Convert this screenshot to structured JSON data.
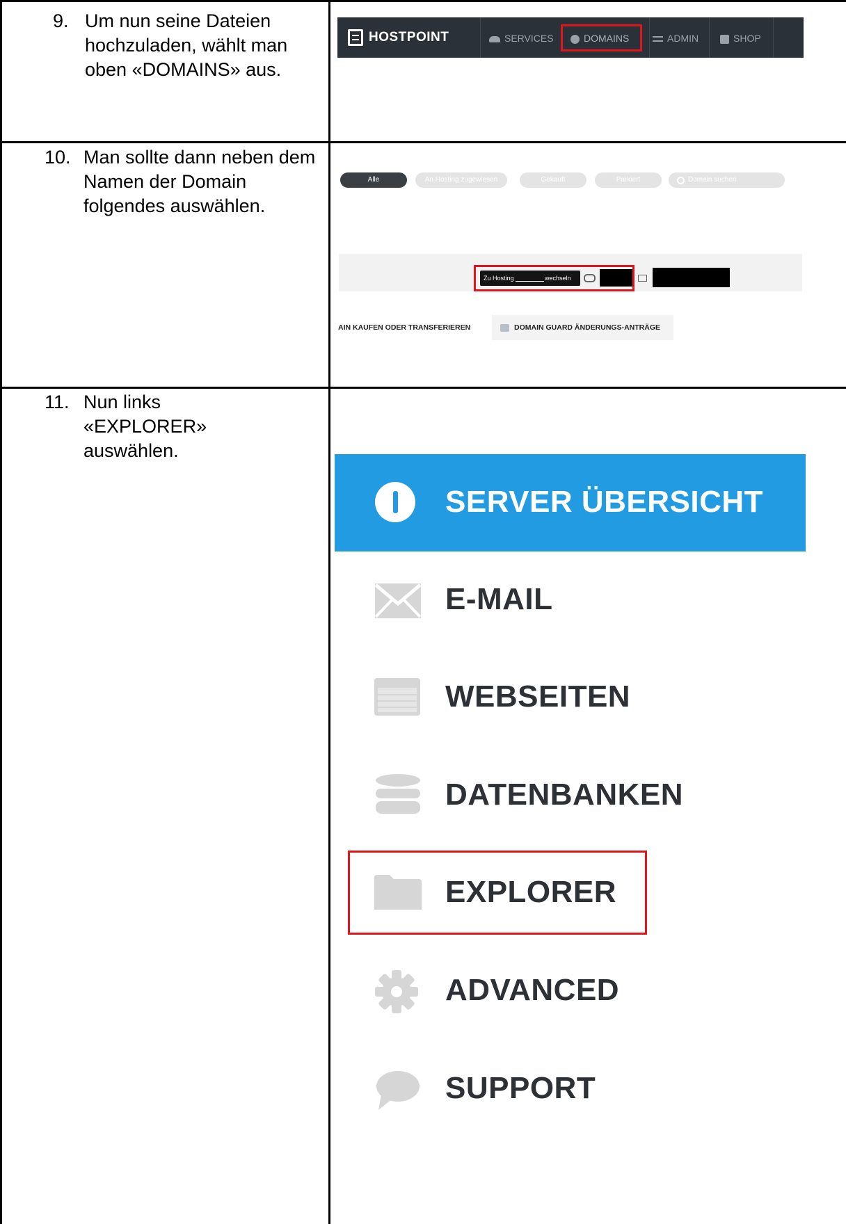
{
  "steps": [
    {
      "number": "9.",
      "text": "Um nun seine Dateien hochzuladen, wählt man oben «DOMAINS» aus."
    },
    {
      "number": "10.",
      "text": "Man sollte dann neben dem Namen der Domain folgendes auswählen."
    },
    {
      "number": "11.",
      "text": "Nun links «EXPLORER» auswählen."
    }
  ],
  "hostpoint_nav": {
    "brand": "HOSTPOINT",
    "items": [
      "SERVICES",
      "DOMAINS",
      "ADMIN",
      "SHOP"
    ],
    "highlighted": "DOMAINS"
  },
  "domains_view": {
    "filters": [
      "Alle",
      "An Hosting zugewiesen",
      "Gekauft",
      "Parkiert"
    ],
    "search_placeholder": "Domain suchen",
    "switch_label_left": "Zu Hosting",
    "switch_label_right": "wechseln",
    "actions": [
      "AIN KAUFEN ODER TRANSFERIEREN",
      "DOMAIN GUARD ÄNDERUNGS-ANTRÄGE"
    ]
  },
  "server_menu": {
    "active": "SERVER ÜBERSICHT",
    "items": [
      "E-MAIL",
      "WEBSEITEN",
      "DATENBANKEN",
      "EXPLORER",
      "ADVANCED",
      "SUPPORT"
    ],
    "highlighted": "EXPLORER",
    "colors": {
      "active_bg": "#229be3",
      "highlight_border": "#e0161c",
      "nav_bg": "#2b3138"
    }
  }
}
